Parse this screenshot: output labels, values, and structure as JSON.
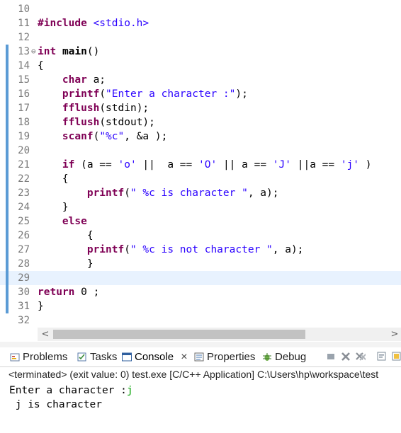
{
  "editor": {
    "lines": [
      {
        "n": "10",
        "code": []
      },
      {
        "n": "11",
        "code": [
          {
            "t": "#include",
            "c": "kw"
          },
          {
            "t": " "
          },
          {
            "t": "<stdio.h>",
            "c": "inc"
          }
        ]
      },
      {
        "n": "12",
        "code": []
      },
      {
        "n": "13",
        "fold": "⊖",
        "bar": true,
        "code": [
          {
            "t": "int",
            "c": "kw"
          },
          {
            "t": " "
          },
          {
            "t": "main",
            "c": "kwb"
          },
          {
            "t": "()"
          }
        ]
      },
      {
        "n": "14",
        "bar": true,
        "code": [
          {
            "t": "{"
          }
        ]
      },
      {
        "n": "15",
        "bar": true,
        "code": [
          {
            "t": "    "
          },
          {
            "t": "char",
            "c": "kw"
          },
          {
            "t": " a;"
          }
        ]
      },
      {
        "n": "16",
        "bar": true,
        "code": [
          {
            "t": "    "
          },
          {
            "t": "printf",
            "c": "kw"
          },
          {
            "t": "("
          },
          {
            "t": "\"Enter a character :\"",
            "c": "str"
          },
          {
            "t": ");"
          }
        ]
      },
      {
        "n": "17",
        "bar": true,
        "code": [
          {
            "t": "    "
          },
          {
            "t": "fflush",
            "c": "kw"
          },
          {
            "t": "(stdin);"
          }
        ]
      },
      {
        "n": "18",
        "bar": true,
        "code": [
          {
            "t": "    "
          },
          {
            "t": "fflush",
            "c": "kw"
          },
          {
            "t": "(stdout);"
          }
        ]
      },
      {
        "n": "19",
        "bar": true,
        "code": [
          {
            "t": "    "
          },
          {
            "t": "scanf",
            "c": "kw"
          },
          {
            "t": "("
          },
          {
            "t": "\"%c\"",
            "c": "str"
          },
          {
            "t": ", &a );"
          }
        ]
      },
      {
        "n": "20",
        "bar": true,
        "code": []
      },
      {
        "n": "21",
        "bar": true,
        "code": [
          {
            "t": "    "
          },
          {
            "t": "if",
            "c": "kw"
          },
          {
            "t": " (a == "
          },
          {
            "t": "'o'",
            "c": "str"
          },
          {
            "t": " ||  a == "
          },
          {
            "t": "'O'",
            "c": "str"
          },
          {
            "t": " || a == "
          },
          {
            "t": "'J'",
            "c": "str"
          },
          {
            "t": " ||a == "
          },
          {
            "t": "'j'",
            "c": "str"
          },
          {
            "t": " )"
          }
        ]
      },
      {
        "n": "22",
        "bar": true,
        "code": [
          {
            "t": "    {"
          }
        ]
      },
      {
        "n": "23",
        "bar": true,
        "code": [
          {
            "t": "        "
          },
          {
            "t": "printf",
            "c": "kw"
          },
          {
            "t": "("
          },
          {
            "t": "\" %c is character \"",
            "c": "str"
          },
          {
            "t": ", a);"
          }
        ]
      },
      {
        "n": "24",
        "bar": true,
        "code": [
          {
            "t": "    }"
          }
        ]
      },
      {
        "n": "25",
        "bar": true,
        "code": [
          {
            "t": "    "
          },
          {
            "t": "else",
            "c": "kw"
          }
        ]
      },
      {
        "n": "26",
        "bar": true,
        "code": [
          {
            "t": "        {"
          }
        ]
      },
      {
        "n": "27",
        "bar": true,
        "code": [
          {
            "t": "        "
          },
          {
            "t": "printf",
            "c": "kw"
          },
          {
            "t": "("
          },
          {
            "t": "\" %c is not character \"",
            "c": "str"
          },
          {
            "t": ", a);"
          }
        ]
      },
      {
        "n": "28",
        "bar": true,
        "code": [
          {
            "t": "        }"
          }
        ]
      },
      {
        "n": "29",
        "bar": true,
        "current": true,
        "code": []
      },
      {
        "n": "30",
        "bar": true,
        "code": [
          {
            "t": "return",
            "c": "kw"
          },
          {
            "t": " 0 ;"
          }
        ]
      },
      {
        "n": "31",
        "bar": true,
        "code": [
          {
            "t": "}"
          }
        ]
      },
      {
        "n": "32",
        "code": []
      }
    ]
  },
  "scrollbar": {
    "left_arrow": "<",
    "right_arrow": ">"
  },
  "console_view": {
    "tabs": [
      {
        "label": "Problems",
        "icon": "problems-icon"
      },
      {
        "label": "Tasks",
        "icon": "tasks-icon"
      },
      {
        "label": "Console",
        "icon": "console-icon",
        "active": true,
        "close": "×"
      },
      {
        "label": "Properties",
        "icon": "properties-icon"
      },
      {
        "label": "Debug",
        "icon": "debug-icon"
      }
    ],
    "status": "<terminated> (exit value: 0) test.exe [C/C++ Application] C:\\Users\\hp\\workspace\\test",
    "output": {
      "prompt": "Enter a character :",
      "typed_input": "j",
      "result": " j is character"
    }
  }
}
